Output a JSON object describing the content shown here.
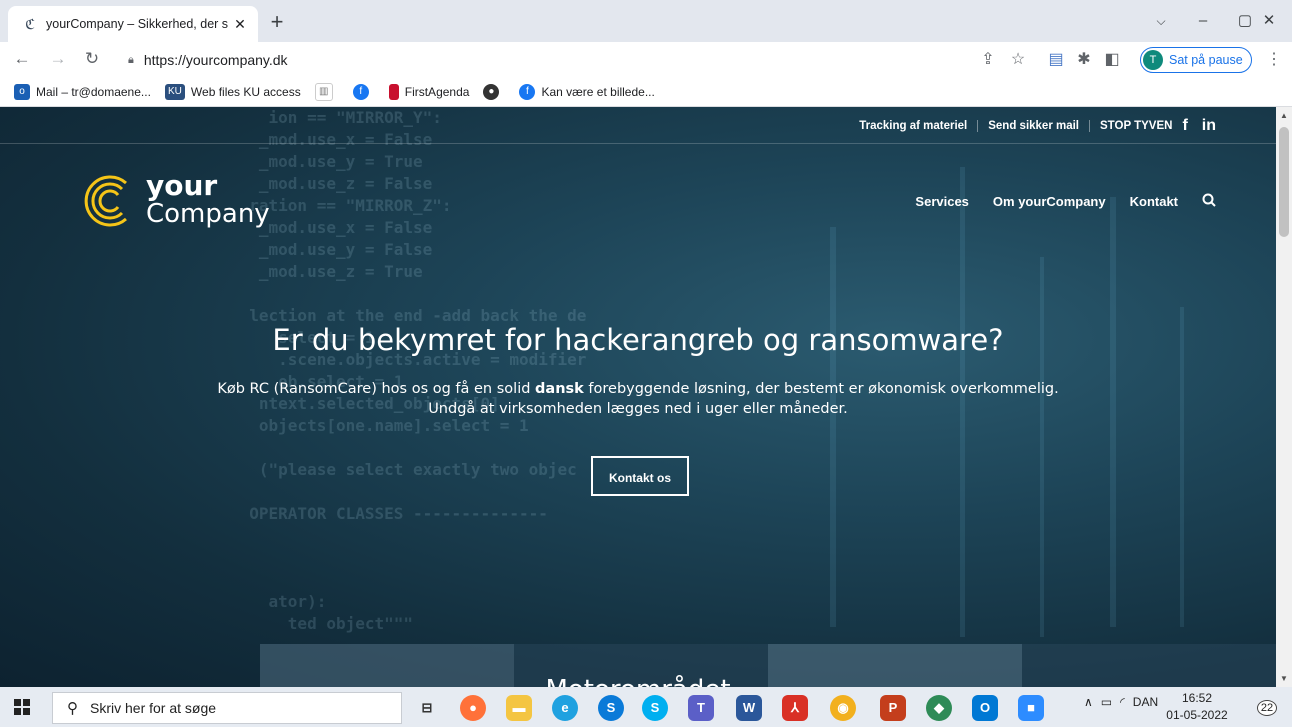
{
  "browser": {
    "tab_title": "yourCompany – Sikkerhed, der s",
    "tab_close": "✕",
    "new_tab": "+",
    "url": "https://yourcompany.dk",
    "profile_initial": "T",
    "profile_status": "Sat på pause",
    "window_controls": {
      "minimize": "–",
      "maximize": "▢",
      "close": "✕"
    }
  },
  "bookmarks": [
    {
      "label": "Mail – tr@domaene...",
      "icon": "outlook-icon",
      "color": "#1a5fb4"
    },
    {
      "label": "Web files KU access",
      "icon": "ku-icon",
      "color": "#2b4f7e"
    },
    {
      "label": "",
      "icon": "library-icon",
      "color": "#888888"
    },
    {
      "label": "",
      "icon": "facebook-icon",
      "color": "#1877f2"
    },
    {
      "label": "FirstAgenda",
      "icon": "firstagenda-icon",
      "color": "#c8102e"
    },
    {
      "label": "",
      "icon": "github-icon",
      "color": "#333333"
    },
    {
      "label": "Kan være et billede...",
      "icon": "facebook-icon",
      "color": "#1877f2"
    }
  ],
  "site": {
    "top_links": [
      "Tracking af materiel",
      "Send sikker mail",
      "STOP TYVEN"
    ],
    "social": {
      "facebook": "f",
      "linkedin": "in"
    },
    "logo": {
      "line1": "your",
      "line2": "Company"
    },
    "nav": [
      "Services",
      "Om yourCompany",
      "Kontakt"
    ],
    "hero": {
      "title": "Er du bekymret for hackerangreb og ransomware?",
      "text_before": "Køb RC (RansomCare) hos os og få en solid ",
      "text_bold": "dansk",
      "text_after": " forebyggende løsning, der bestemt er økonomisk overkommelig.",
      "text_line2": "Undgå at virksomheden lægges ned i uger eller måneder.",
      "cta": "Kontakt os"
    },
    "next_section_title": "Motorområdet"
  },
  "taskbar": {
    "search_placeholder": "Skriv her for at søge",
    "language": "DAN",
    "time": "16:52",
    "date": "01-05-2022",
    "notifications": "22"
  }
}
